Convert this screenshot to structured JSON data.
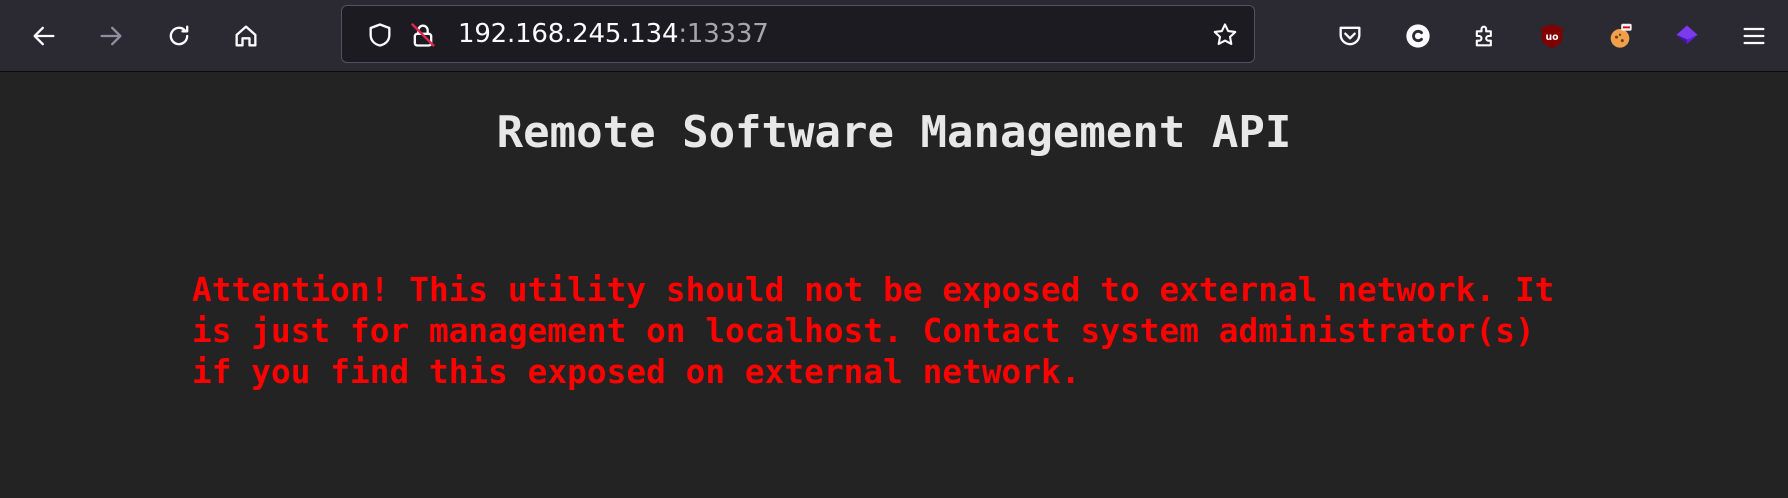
{
  "browser": {
    "url": {
      "host": "192.168.245.134",
      "port": ":13337"
    },
    "icons": {
      "back": "arrow-left-icon",
      "forward": "arrow-right-icon",
      "reload": "reload-icon",
      "home": "home-icon",
      "tracking_protection": "shield-icon",
      "insecure_connection": "crossed-lock-icon",
      "bookmark": "star-icon",
      "pocket": "pocket-icon",
      "extension_c": "c-extension-icon",
      "extensions": "puzzle-icon",
      "ublock": "ublock-origin-icon",
      "extension_cookie": "cookie-extension-icon",
      "extension_purple": "purple-diamond-extension-icon",
      "menu": "hamburger-menu-icon"
    },
    "colors": {
      "toolbar_bg": "#2b2a33",
      "urlbar_bg": "#1c1b22",
      "content_bg": "#232323",
      "warning_text": "#ff0000"
    }
  },
  "page": {
    "title": "Remote Software Management API",
    "warning": "Attention! This utility should not be exposed to external network. It\nis just for management on localhost. Contact system administrator(s)\nif you find this exposed on external network."
  }
}
